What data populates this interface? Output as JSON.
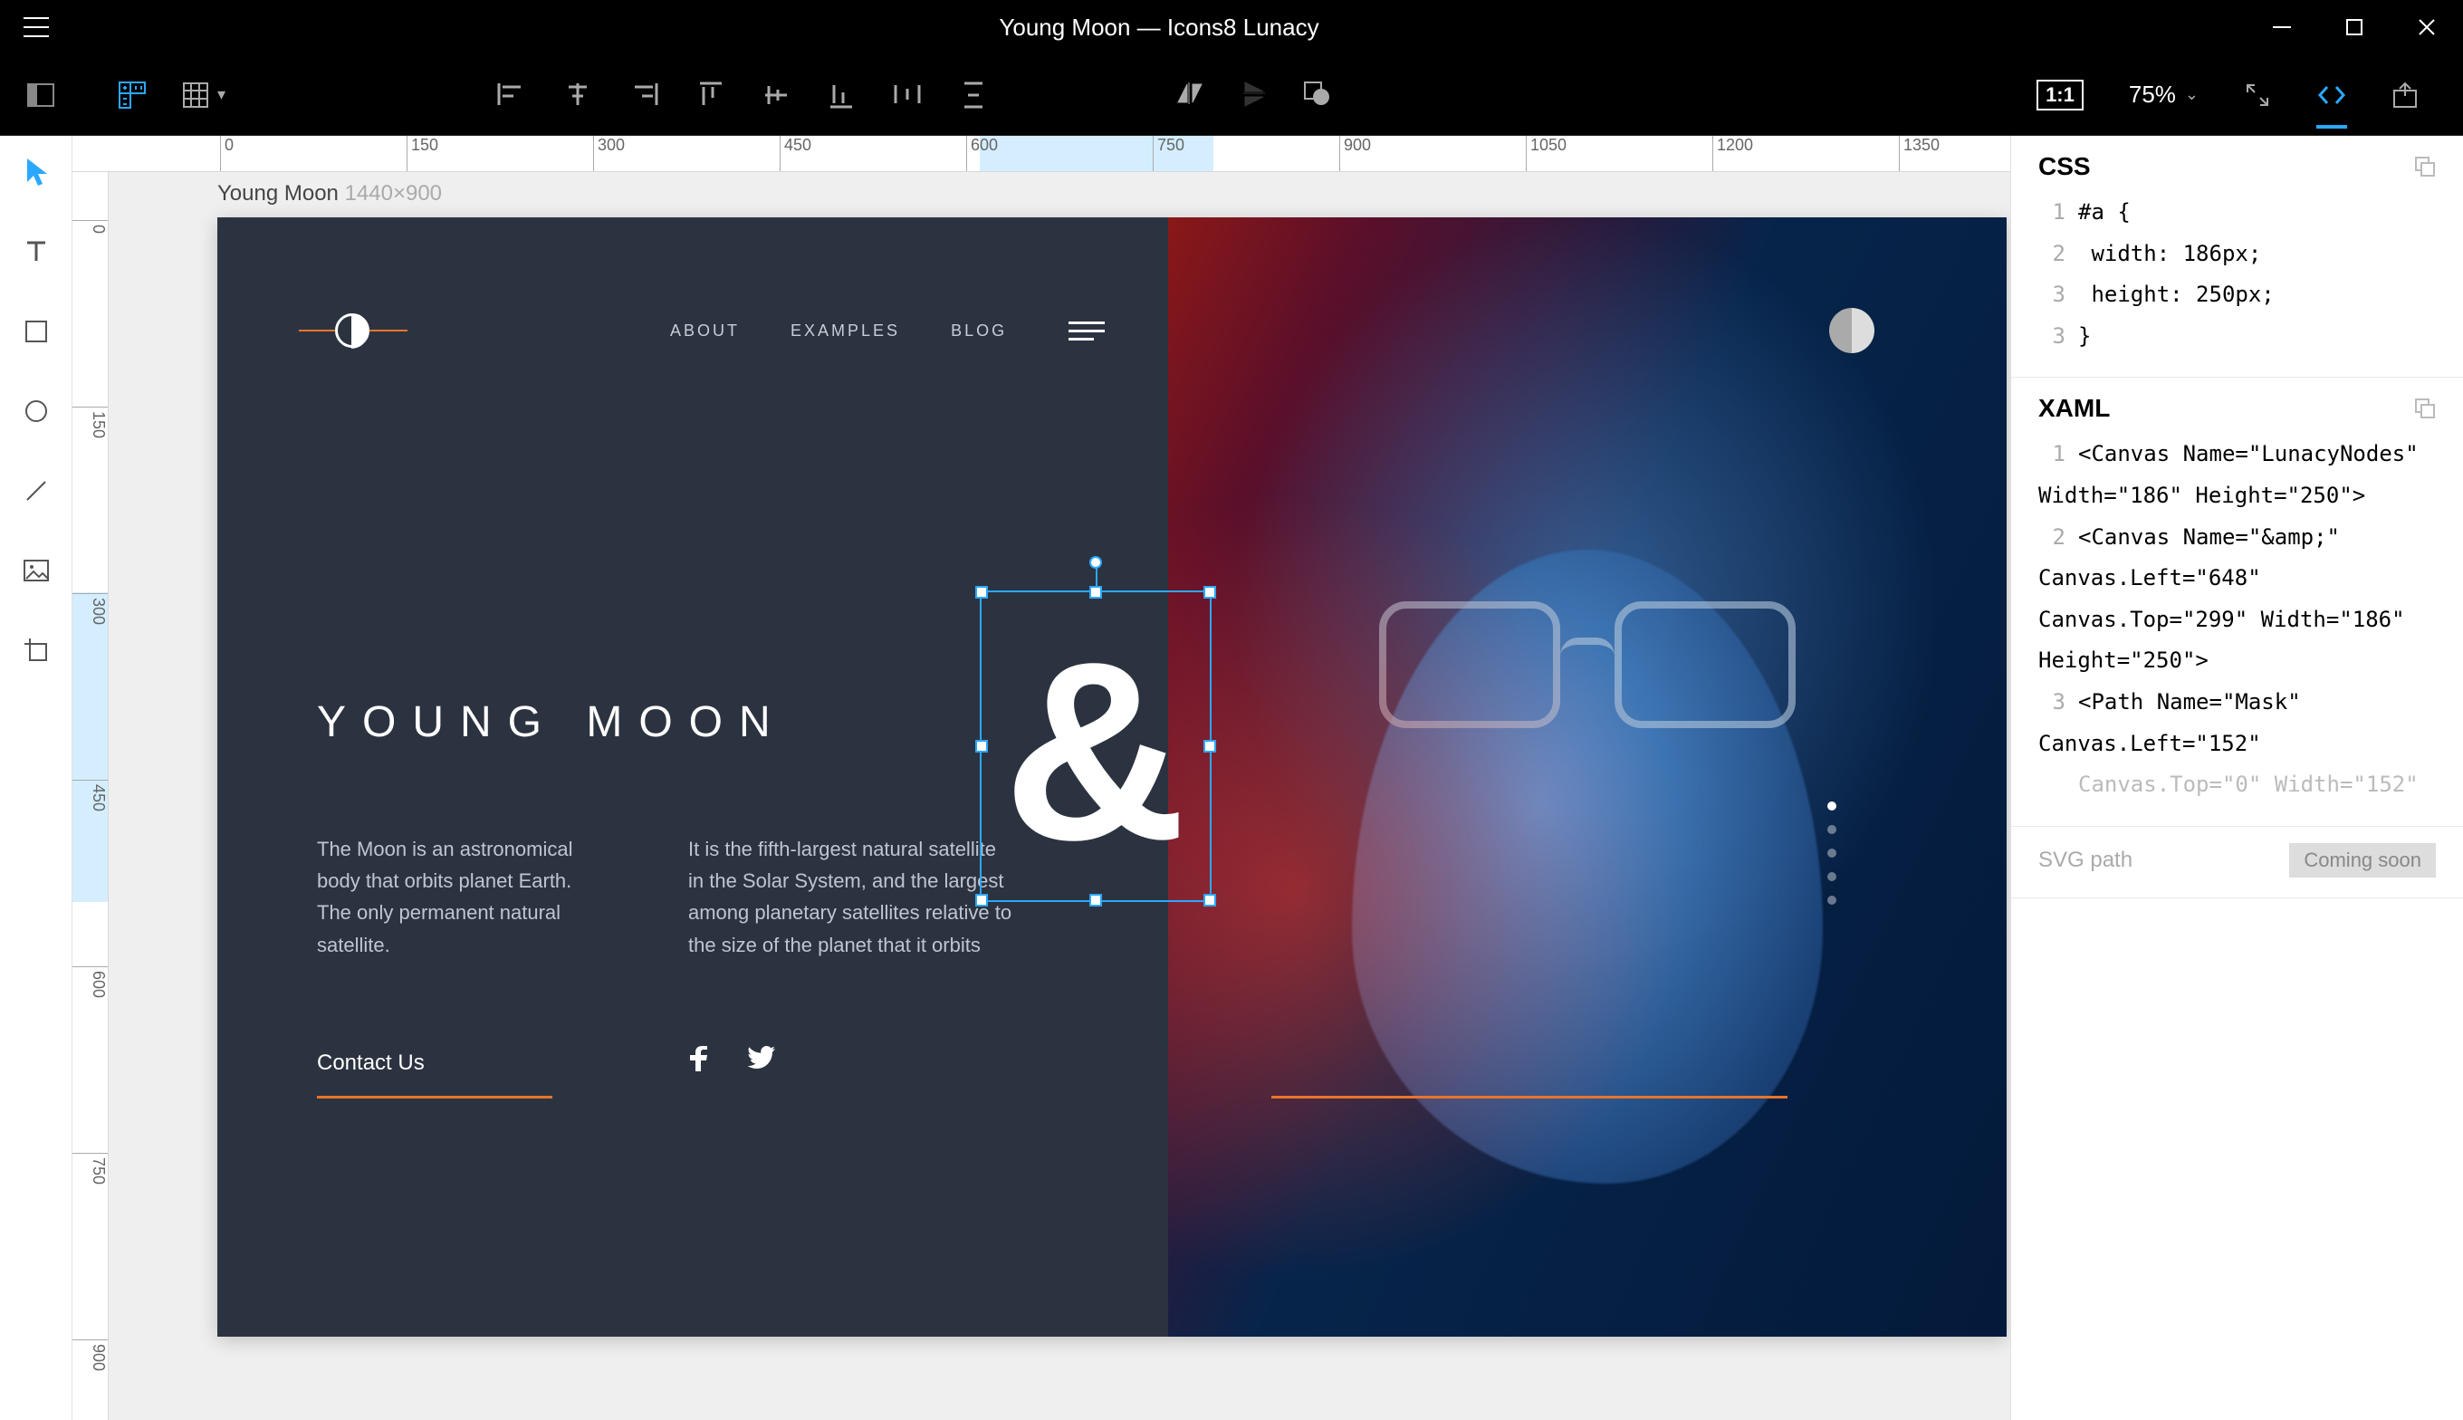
{
  "titlebar": {
    "title": "Young Moon — Icons8 Lunacy"
  },
  "toolbar": {
    "scale_label": "1:1",
    "zoom": "75%"
  },
  "artboard": {
    "name": "Young Moon",
    "dimensions": "1440×900",
    "nav": {
      "about": "ABOUT",
      "examples": "EXAMPLES",
      "blog": "BLOG"
    },
    "heading": "YOUNG MOON",
    "para1": "The Moon is an astronomical body that orbits planet Earth. The only permanent natural satellite.",
    "para2": "It is the fifth-largest natural satellite in the Solar System, and the largest among planetary satellites relative to the size of the planet that it orbits",
    "contact": "Contact Us",
    "ampersand": "&"
  },
  "hruler": {
    "ticks": [
      "0",
      "150",
      "300",
      "450",
      "600",
      "750",
      "900",
      "1050",
      "1200",
      "1350"
    ]
  },
  "vruler": {
    "ticks": [
      "0",
      "150",
      "300",
      "450",
      "600",
      "750",
      "900"
    ]
  },
  "panel": {
    "css_title": "CSS",
    "css_lines": {
      "l1": "#a {",
      "l2": "  width: 186px;",
      "l3": "  height: 250px;",
      "l4": "}"
    },
    "xaml_title": "XAML",
    "xaml": {
      "l1": "<Canvas Name=\"LunacyNodes\" Width=\"186\" Height=\"250\">",
      "l2": "<Canvas Name=\"&amp;\" Canvas.Left=\"648\" Canvas.Top=\"299\" Width=\"186\" Height=\"250\">",
      "l3a": "<Path Name=\"Mask\" Canvas.Left=\"152\"",
      "l3b": "Canvas.Top=\"0\" Width=\"152\""
    },
    "svg_title": "SVG path",
    "svg_badge": "Coming soon"
  }
}
